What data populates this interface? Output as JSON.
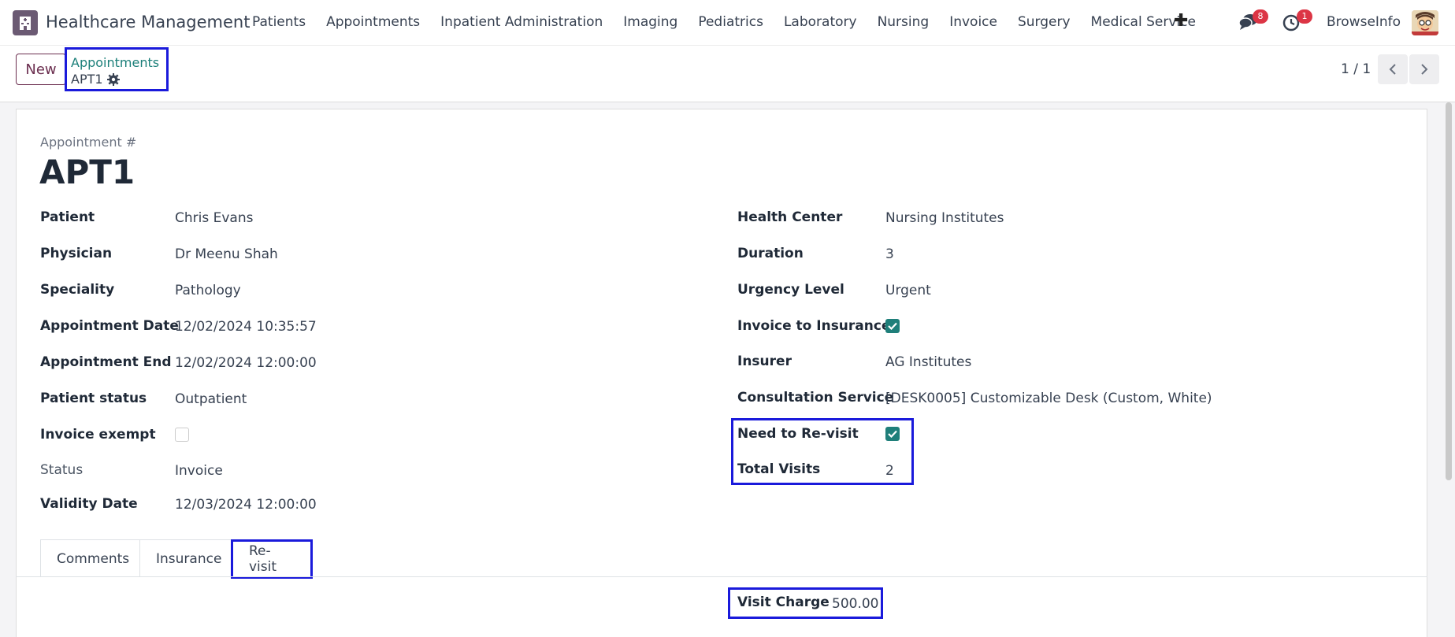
{
  "navbar": {
    "app_title": "Healthcare Management",
    "menu": [
      "Patients",
      "Appointments",
      "Inpatient Administration",
      "Imaging",
      "Pediatrics",
      "Laboratory",
      "Nursing",
      "Invoice",
      "Surgery",
      "Medical Service"
    ],
    "plus": "✚",
    "messages_count": "8",
    "activities_count": "1",
    "user_name": "BrowseInfo"
  },
  "control_panel": {
    "new_label": "New",
    "breadcrumb_parent": "Appointments",
    "breadcrumb_current": "APT1",
    "pager": "1 / 1"
  },
  "form": {
    "number_label": "Appointment #",
    "title": "APT1",
    "left_fields": [
      {
        "label": "Patient",
        "value": "Chris Evans"
      },
      {
        "label": "Physician",
        "value": "Dr Meenu Shah"
      },
      {
        "label": "Speciality",
        "value": "Pathology"
      },
      {
        "label": "Appointment Date",
        "value": "12/02/2024 10:35:57"
      },
      {
        "label": "Appointment End",
        "value": "12/02/2024 12:00:00"
      },
      {
        "label": "Patient status",
        "value": "Outpatient"
      },
      {
        "label": "Invoice exempt",
        "value": ""
      },
      {
        "label": "Status",
        "value": "Invoice"
      },
      {
        "label": "Validity Date",
        "value": "12/03/2024 12:00:00"
      }
    ],
    "invoice_exempt_checked": false,
    "right_fields": [
      {
        "label": "Health Center",
        "value": "Nursing Institutes"
      },
      {
        "label": "Duration",
        "value": "3"
      },
      {
        "label": "Urgency Level",
        "value": "Urgent"
      },
      {
        "label": "Invoice to Insurance",
        "value": ""
      },
      {
        "label": "Insurer",
        "value": "AG Institutes"
      },
      {
        "label": "Consultation Service",
        "value": "[DESK0005] Customizable Desk (Custom, White)"
      },
      {
        "label": "Need to Re-visit",
        "value": ""
      },
      {
        "label": "Total Visits",
        "value": "2"
      }
    ],
    "invoice_to_insurance_checked": true,
    "need_revisit_checked": true,
    "tabs": [
      "Comments",
      "Insurance",
      "Re-visit"
    ],
    "active_tab": "Re-visit",
    "visit_charge_label": "Visit Charge",
    "visit_charge_value": "500.00"
  },
  "colors": {
    "accent": "#1f7f7a",
    "brand": "#6b2e4f",
    "highlight": "#1a1adb",
    "badge": "#dc3545"
  }
}
